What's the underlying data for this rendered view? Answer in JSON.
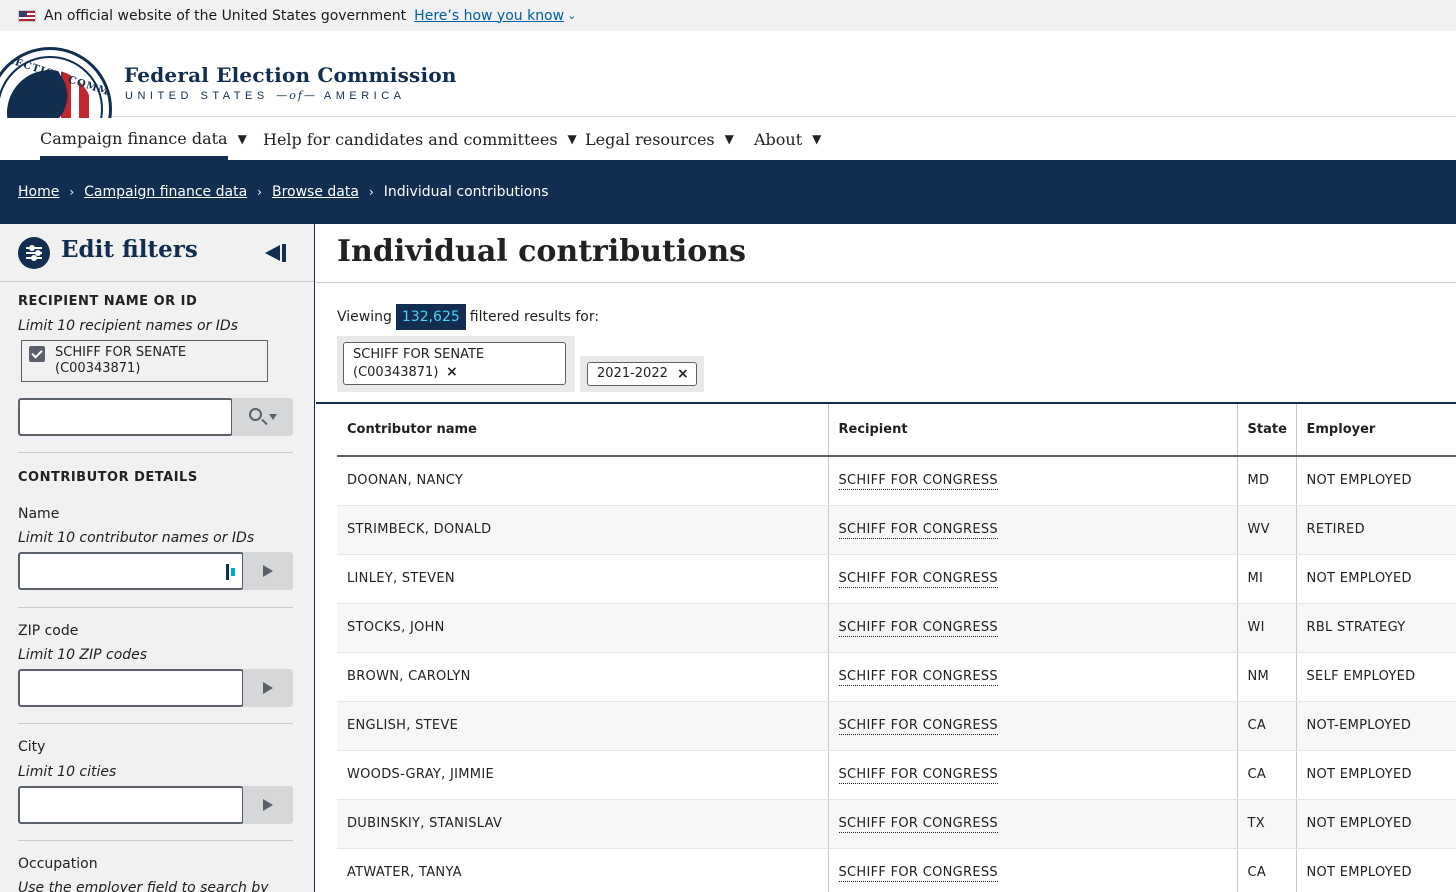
{
  "gov_banner": {
    "text": "An official website of the United States government",
    "link": "Here’s how you know",
    "chevron": "⌄"
  },
  "header": {
    "seal_text": "ELECTION COMMISSION",
    "title": "Federal Election Commission",
    "subtitle_left": "UNITED STATES",
    "subtitle_of": "—of—",
    "subtitle_right": "AMERICA"
  },
  "nav": {
    "items": [
      {
        "label": "Campaign finance data",
        "icon": "caret-down-icon"
      },
      {
        "label": "Help for candidates and committees",
        "icon": "caret-down-icon"
      },
      {
        "label": "Legal resources",
        "icon": "caret-down-icon"
      },
      {
        "label": "About",
        "icon": "caret-down-icon"
      }
    ],
    "caret": "▼"
  },
  "breadcrumb": {
    "items": [
      "Home",
      "Campaign finance data",
      "Browse data"
    ],
    "current": "Individual contributions",
    "separator": "›"
  },
  "sidebar": {
    "title": "Edit filters",
    "recipient": {
      "section_title": "RECIPIENT NAME OR ID",
      "hint": "Limit 10 recipient names or IDs",
      "selected_line1": "SCHIFF FOR SENATE",
      "selected_line2": "(C00343871)",
      "input_value": ""
    },
    "contributor": {
      "section_title": "CONTRIBUTOR DETAILS",
      "name_label": "Name",
      "name_hint": "Limit 10 contributor names or IDs",
      "zip_label": "ZIP code",
      "zip_hint": "Limit 10 ZIP codes",
      "city_label": "City",
      "city_hint": "Limit 10 cities",
      "occupation_label": "Occupation",
      "occupation_hint": "Use the employer field to search by"
    }
  },
  "main": {
    "title": "Individual contributions",
    "viewing_prefix": "Viewing",
    "count": "132,625",
    "viewing_suffix": "filtered results for:",
    "tags": [
      {
        "line1": "SCHIFF FOR SENATE",
        "line2": "(C00343871)"
      },
      {
        "line1": "2021-2022"
      }
    ],
    "tag_close": "×",
    "table": {
      "headers": [
        "Contributor name",
        "Recipient",
        "State",
        "Employer"
      ],
      "rows": [
        [
          "DOONAN, NANCY",
          "SCHIFF FOR CONGRESS",
          "MD",
          "NOT EMPLOYED"
        ],
        [
          "STRIMBECK, DONALD",
          "SCHIFF FOR CONGRESS",
          "WV",
          "RETIRED"
        ],
        [
          "LINLEY, STEVEN",
          "SCHIFF FOR CONGRESS",
          "MI",
          "NOT EMPLOYED"
        ],
        [
          "STOCKS, JOHN",
          "SCHIFF FOR CONGRESS",
          "WI",
          "RBL STRATEGY"
        ],
        [
          "BROWN, CAROLYN",
          "SCHIFF FOR CONGRESS",
          "NM",
          "SELF EMPLOYED"
        ],
        [
          "ENGLISH, STEVE",
          "SCHIFF FOR CONGRESS",
          "CA",
          "NOT-EMPLOYED"
        ],
        [
          "WOODS-GRAY, JIMMIE",
          "SCHIFF FOR CONGRESS",
          "CA",
          "NOT EMPLOYED"
        ],
        [
          "DUBINSKIY, STANISLAV",
          "SCHIFF FOR CONGRESS",
          "TX",
          "NOT EMPLOYED"
        ],
        [
          "ATWATER, TANYA",
          "SCHIFF FOR CONGRESS",
          "CA",
          "NOT EMPLOYED"
        ]
      ]
    }
  },
  "colors": {
    "navy": "#112e51",
    "badge_text": "#4ad2f5",
    "sidebar_bg": "#f1f1f1"
  }
}
